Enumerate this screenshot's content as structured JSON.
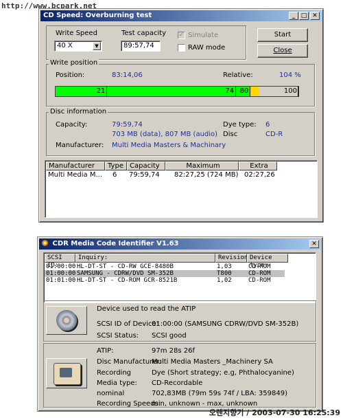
{
  "watermark_top": "http://www.bcpark.net",
  "watermark_bottom": "오렌지향기 / 2003-07-30 16:25:39",
  "cdspeed": {
    "title": "CD Speed: Overburning test",
    "write_speed_label": "Write Speed",
    "write_speed_value": "40 X",
    "test_capacity_label": "Test capacity",
    "test_capacity_value": "89:57,74",
    "simulate_label": "Simulate",
    "raw_mode_label": "RAW mode",
    "start_label": "Start",
    "close_label": "Close",
    "write_position": {
      "legend": "Write position",
      "position_label": "Position:",
      "position_value": "83:14,06",
      "relative_label": "Relative:",
      "relative_value": "104 %",
      "bar": {
        "green_fraction": 0.8,
        "yellow_fraction": 0.84,
        "marks": [
          "21",
          "74",
          "80",
          "100"
        ],
        "colors": {
          "green": "#00ff00",
          "yellow": "#ffd800"
        }
      }
    },
    "disc_info": {
      "legend": "Disc information",
      "capacity_label": "Capacity:",
      "capacity_value": "79:59,74",
      "capacity_detail": "703 MB (data), 807 MB (audio)",
      "manufacturer_label": "Manufacturer:",
      "manufacturer_value": "Multi Media Masters & Machinary",
      "dye_type_label": "Dye type:",
      "dye_type_value": "6",
      "disc_label": "Disc",
      "disc_value": "CD-R"
    },
    "table": {
      "headers": [
        "Manufacturer",
        "Type",
        "Capacity",
        "Maximum",
        "Extra"
      ],
      "rows": [
        [
          "Multi Media M...",
          "6",
          "79:59,74",
          "82:27,25 (724 MB)",
          "02:27,26"
        ]
      ]
    }
  },
  "cdr": {
    "title": "CDR Media Code Identifier V1.63",
    "headers": [
      "SCSI ID:",
      "Inquiry:",
      "Revision:",
      "Device type:"
    ],
    "rows": [
      [
        "01:00:00",
        "HL-DT-ST - CD-RW GCE-8480B",
        "1,03",
        "CD-ROM"
      ],
      [
        "01:00:00",
        "SAMSUNG - CDRW/DVD SM-352B",
        "T800",
        "CD-ROM"
      ],
      [
        "01:01:00",
        "HL-DT-ST - CD-ROM GCR-8521B",
        "1,02",
        "CD-ROM"
      ]
    ],
    "device_used": "Device used to read the ATIP",
    "scsi_id_label": "SCSI ID of Device:",
    "scsi_id_value": "01:00:00 (SAMSUNG CDRW/DVD SM-352B)",
    "scsi_status_label": "SCSI Status:",
    "scsi_status_value": "SCSI good",
    "atip_label": "ATIP:",
    "atip_value": "97m 28s 26f",
    "disc_mfr_label": "Disc Manufacturer:",
    "disc_mfr_value": "Multi Media Masters _Machinery SA",
    "recording_label": "Recording",
    "recording_value": "Dye (Short strategy; e.g, Phthalocyanine)",
    "media_type_label": "Media type:",
    "media_type_value": "CD-Recordable",
    "nominal_label": "nominal",
    "nominal_value": "702,83MB (79m 59s 74f / LBA: 359849)",
    "speeds_label": "Recording Speeds:",
    "speeds_value": "min, unknown - max, unknown"
  }
}
